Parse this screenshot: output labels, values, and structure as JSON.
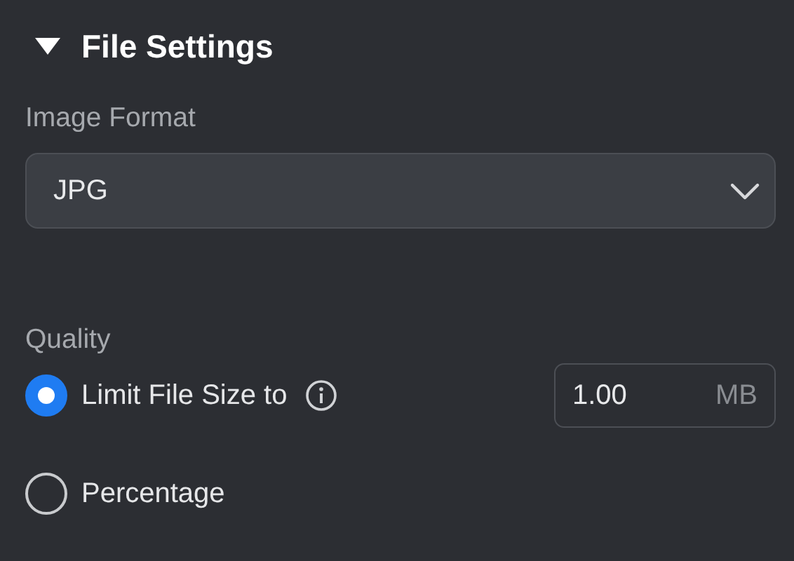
{
  "section": {
    "title": "File Settings",
    "expanded": true
  },
  "image_format": {
    "label": "Image Format",
    "value": "JPG"
  },
  "quality": {
    "label": "Quality",
    "options": [
      {
        "label": "Limit File Size to",
        "selected": true,
        "info": true,
        "field": {
          "value": "1.00",
          "unit": "MB"
        }
      },
      {
        "label": "Percentage",
        "selected": false,
        "info": false
      }
    ]
  }
}
